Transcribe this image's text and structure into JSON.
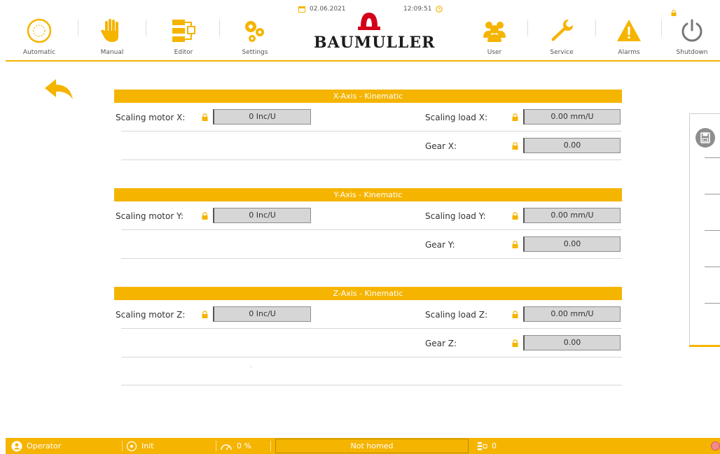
{
  "toolbar": {
    "automatic": "Automatic",
    "manual": "Manual",
    "editor": "Editor",
    "settings": "Settings",
    "user": "User",
    "service": "Service",
    "alarms": "Alarms",
    "shutdown": "Shutdown",
    "date": "02.06.2021",
    "time": "12:09:51",
    "brand": "BAUMULLER"
  },
  "x_axis": {
    "title": "X-Axis - Kinematic",
    "scaling_motor_label": "Scaling motor X:",
    "scaling_motor_value": "0 Inc/U",
    "scaling_load_label": "Scaling load X:",
    "scaling_load_value": "0.00 mm/U",
    "gear_label": "Gear X:",
    "gear_value": "0.00"
  },
  "y_axis": {
    "title": "Y-Axis - Kinematic",
    "scaling_motor_label": "Scaling motor Y:",
    "scaling_motor_value": "0 Inc/U",
    "scaling_load_label": "Scaling load Y:",
    "scaling_load_value": "0.00 mm/U",
    "gear_label": "Gear Y:",
    "gear_value": "0.00"
  },
  "z_axis": {
    "title": "Z-Axis - Kinematic",
    "scaling_motor_label": "Scaling motor Z:",
    "scaling_motor_value": "0 Inc/U",
    "scaling_load_label": "Scaling load Z:",
    "scaling_load_value": "0.00 mm/U",
    "gear_label": "Gear Z:",
    "gear_value": "0.00"
  },
  "statusbar": {
    "user": "Operator",
    "mode": "Init",
    "override": "0 %",
    "homing": "Not homed",
    "program": "0"
  },
  "colors": {
    "accent": "#f5b400",
    "value_box": "#d6d6d6"
  },
  "icons": {
    "automatic": "circle-icon",
    "manual": "hand-icon",
    "editor": "flowchart-icon",
    "settings": "gears-icon",
    "user": "users-icon",
    "service": "wrench-icon",
    "alarms": "warning-icon",
    "shutdown": "power-icon",
    "back": "back-arrow-icon",
    "save": "floppy-icon",
    "lock": "lock-icon"
  }
}
